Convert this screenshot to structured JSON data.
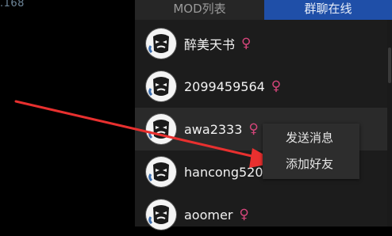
{
  "background": {
    "ip_fragment": ".168"
  },
  "tabs": [
    {
      "label": "MOD列表",
      "active": false
    },
    {
      "label": "群聊在线",
      "active": true
    }
  ],
  "users": [
    {
      "name": "醉美天书",
      "gender": "♀"
    },
    {
      "name": "2099459564",
      "gender": "♀"
    },
    {
      "name": "awa2333",
      "gender": "♀"
    },
    {
      "name": "hancong520",
      "gender": ""
    },
    {
      "name": "aoomer",
      "gender": "♀"
    }
  ],
  "context_menu": {
    "items": [
      "发送消息",
      "添加好友"
    ]
  },
  "colors": {
    "accent_tab": "#1f4fa8",
    "female_icon": "#d4457a",
    "annotation_arrow": "#e8302f"
  },
  "icons": {
    "avatar": "avatar-icon",
    "gender": "female-icon"
  }
}
